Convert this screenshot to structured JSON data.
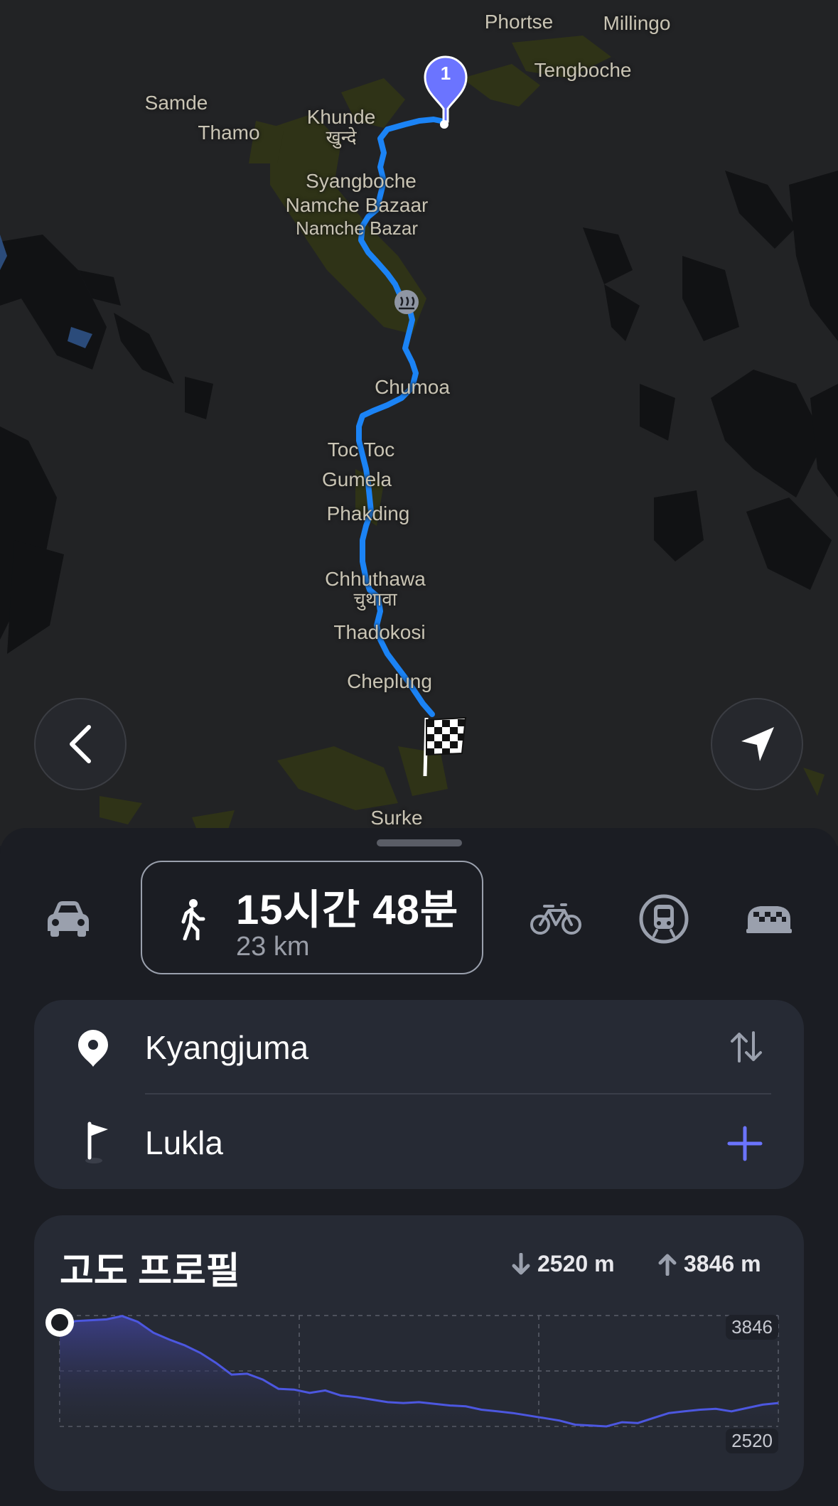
{
  "map": {
    "places": [
      {
        "name": "Phortse"
      },
      {
        "name": "Millingo"
      },
      {
        "name": "Tengboche"
      },
      {
        "name": "Samde"
      },
      {
        "name": "Thamo"
      },
      {
        "name": "Khunde"
      },
      {
        "name": "खुन्दे"
      },
      {
        "name": "Syangboche"
      },
      {
        "name": "Namche Bazaar"
      },
      {
        "name": "Namche Bazar"
      },
      {
        "name": "Chumoa"
      },
      {
        "name": "Toc Toc"
      },
      {
        "name": "Gumela"
      },
      {
        "name": "Phakding"
      },
      {
        "name": "Chhuthawa"
      },
      {
        "name": "चुथावा"
      },
      {
        "name": "Thadokosi"
      },
      {
        "name": "Cheplung"
      },
      {
        "name": "Surke"
      }
    ],
    "start_marker_label": "1",
    "route_color": "#1b83f5",
    "back_icon": "chevron-left-icon",
    "locate_icon": "navigation-arrow-icon"
  },
  "modes": {
    "items": [
      "car",
      "walk",
      "bike",
      "transit",
      "taxi"
    ],
    "selected": "walk",
    "duration": "15시간 48분",
    "distance": "23 km"
  },
  "route": {
    "from": "Kyangjuma",
    "to": "Lukla",
    "swap_icon": "swap-arrows-icon",
    "add_icon": "plus-icon",
    "accent": "#6b74ff"
  },
  "elevation": {
    "title": "고도 프로필",
    "descent": "2520 m",
    "ascent": "3846 m",
    "ymax_label": "3846",
    "ymin_label": "2520"
  },
  "chart_data": {
    "type": "area",
    "x": [
      0,
      0.5,
      1,
      1.5,
      2,
      2.5,
      3,
      3.5,
      4,
      4.5,
      5,
      5.5,
      6,
      6.5,
      7,
      7.5,
      8,
      8.5,
      9,
      9.5,
      10,
      10.5,
      11,
      11.5,
      12,
      12.5,
      13,
      13.5,
      14,
      14.5,
      15,
      15.5,
      16,
      16.5,
      17,
      17.5,
      18,
      18.5,
      19,
      19.5,
      20,
      20.5,
      21,
      21.5,
      22,
      22.5,
      23
    ],
    "values": [
      3720,
      3780,
      3790,
      3800,
      3840,
      3770,
      3640,
      3560,
      3490,
      3400,
      3280,
      3140,
      3150,
      3080,
      2970,
      2960,
      2920,
      2950,
      2890,
      2870,
      2840,
      2810,
      2800,
      2810,
      2790,
      2770,
      2760,
      2720,
      2700,
      2680,
      2650,
      2620,
      2590,
      2540,
      2530,
      2520,
      2570,
      2560,
      2620,
      2680,
      2700,
      2720,
      2730,
      2700,
      2740,
      2780,
      2800
    ],
    "ylim": [
      2520,
      3846
    ],
    "series": [
      {
        "values_ref": "values"
      }
    ],
    "grid": true,
    "color": "#4c57e0"
  }
}
